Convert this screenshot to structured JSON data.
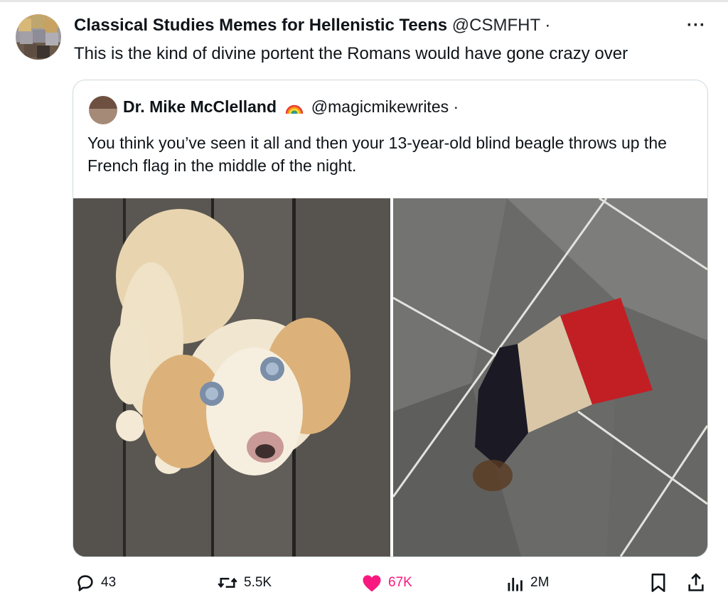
{
  "post": {
    "author_name": "Classical Studies Memes for Hellenistic Teens",
    "author_handle": "@CSMFHT",
    "separator": "·",
    "more": "···",
    "text": "This is the kind of divine portent the Romans would have gone crazy over"
  },
  "quoted": {
    "author_name": "Dr. Mike McClelland",
    "author_handle": "@magicmikewrites",
    "separator": "·",
    "text": "You think you’ve seen it all and then your 13-year-old blind beagle throws up the French flag in the middle of the night.",
    "images": [
      {
        "alt": "blind beagle on wooden deck",
        "icon": "dog-photo"
      },
      {
        "alt": "vomit shaped like French flag on tile floor",
        "icon": "flag-photo"
      }
    ]
  },
  "actions": {
    "replies": "43",
    "reposts": "5.5K",
    "likes": "67K",
    "views": "2M"
  },
  "colors": {
    "like": "#f91880",
    "muted": "#536471",
    "border": "#cfd9de"
  }
}
